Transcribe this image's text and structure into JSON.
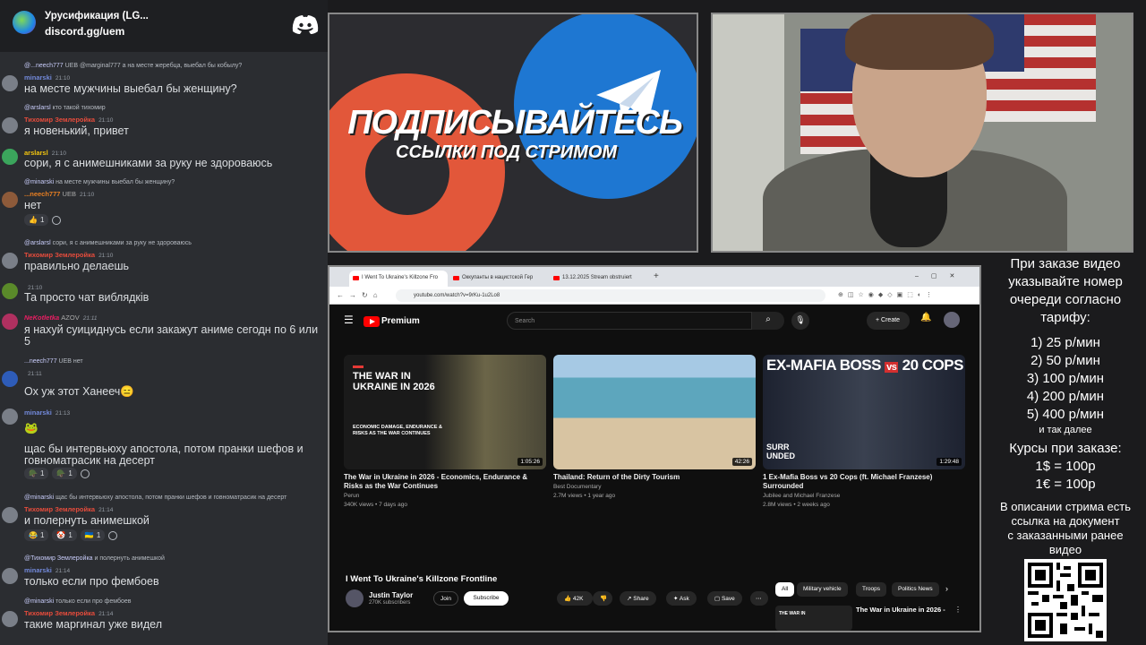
{
  "chat": {
    "server_name": "Урусификация (LG...",
    "invite": "discord.gg/uem",
    "messages": [
      {
        "reply_name": "@...neech777",
        "reply_badges": "UEB",
        "reply_text": "@marginal777 а на месте жеребца, выебал бы кобылу?",
        "author": "minarski",
        "author_color": "#7289da",
        "time": "21:10",
        "text": "на месте мужчины выебал бы женщину?"
      },
      {
        "reply_name": "@arslarsl",
        "reply_text": "кто такой тихомир",
        "author": "Тихомир Землеройка",
        "author_color": "#e74c3c",
        "time": "21:10",
        "text": "я новенький, привет"
      },
      {
        "author": "arslarsl",
        "author_color": "#f1c40f",
        "time": "21:10",
        "text": "сори, я с анимешниками за руку не здороваюсь"
      },
      {
        "reply_name": "@minarski",
        "reply_text": "на месте мужчины выебал бы женщину?",
        "author": "...neech777",
        "author_color": "#e67e22",
        "badges": "UEB",
        "time": "21:10",
        "text": "нет",
        "reactions": [
          {
            "emoji": "👍",
            "count": "1"
          }
        ]
      },
      {
        "reply_name": "@arslarsl",
        "reply_text": "сори, я с анимешниками за руку не здороваюсь",
        "author": "Тихомир Землеройка",
        "author_color": "#e74c3c",
        "time": "21:10",
        "text": "правильно делаешь"
      },
      {
        "author": "",
        "time": "21:10",
        "text": "Та просто чат виблядків"
      },
      {
        "author": "NeKotletka",
        "author_color": "#e91e63",
        "badges": "AZOV",
        "time": "21:11",
        "text": "я нахуй суициднусь если закажут  аниме сегодн по 6 или 5"
      },
      {
        "reply_name": "...neech777",
        "reply_badges": "UEB",
        "reply_text": "нет",
        "author": "",
        "time": "21:11",
        "text": "Ох уж этот Ханееч😑"
      },
      {
        "author": "minarski",
        "author_color": "#7289da",
        "time": "21:13",
        "text": "🐸",
        "text2": "щас бы интервьюху апостола, потом пранки шефов и говноматрасик на десерт",
        "reactions": [
          {
            "emoji": "🪖",
            "count": "1"
          },
          {
            "emoji": "🪖",
            "count": "1"
          }
        ]
      },
      {
        "reply_name": "@minarski",
        "reply_text": "щас бы интервьюху апостола, потом пранки шефов и говноматрасик на десерт",
        "author": "Тихомир Землеройка",
        "author_color": "#e74c3c",
        "time": "21:14",
        "text": "и полернуть анимешкой",
        "reactions": [
          {
            "emoji": "😂",
            "count": "1"
          },
          {
            "emoji": "🤡",
            "count": "1"
          },
          {
            "emoji": "🇺🇦",
            "count": "1"
          }
        ]
      },
      {
        "reply_name": "@Тихомир Землеройка",
        "reply_text": "и полернуть анимешкой",
        "author": "minarski",
        "author_color": "#7289da",
        "time": "21:14",
        "text": "только если про фембоев"
      },
      {
        "reply_name": "@minarski",
        "reply_text": "только если про фембоев",
        "author": "Тихомир Землеройка",
        "author_color": "#e74c3c",
        "time": "21:14",
        "text": "такие маргинал уже видел"
      }
    ]
  },
  "promo": {
    "title": "ПОДПИСЫВАЙТЕСЬ",
    "subtitle": "ССЫЛКИ ПОД СТРИМОМ"
  },
  "browser": {
    "tabs": [
      "I Went To Ukraine's Killzone Fro",
      "Оккупанты в нацистской Гер",
      "13.12.2025 Stream obstruiert"
    ],
    "url": "youtube.com/watch?v=9rKu-1u2Lo8",
    "search_placeholder": "Search",
    "brand": "Premium",
    "create_label": "Create",
    "videos": [
      {
        "title": "The War in Ukraine in 2026 - Economics, Endurance & Risks as the War Continues",
        "channel": "Perun",
        "meta": "340K views • 7 days ago",
        "duration": "1:05:26",
        "thumb_text": "THE WAR IN UKRAINE IN 2026",
        "thumb_sub": "ECONOMIC DAMAGE, ENDURANCE & RISKS AS THE WAR CONTINUES"
      },
      {
        "title": "Thailand: Return of the Dirty Tourism",
        "channel": "Best Documentary",
        "meta": "2.7M views • 1 year ago",
        "duration": "42:26"
      },
      {
        "title": "1 Ex-Mafia Boss vs 20 Cops (ft. Michael Franzese) Surrounded",
        "channel": "Jubilee and Michael Franzese",
        "meta": "2.8M views • 2 weeks ago",
        "duration": "1:29:48",
        "thumb_text": "EX-MAFIA BOSS",
        "thumb_vs": "vs",
        "thumb_right": "20 COPS",
        "thumb_corner": "SURR UNDED"
      }
    ],
    "main_title": "I Went To Ukraine's Killzone Frontline",
    "channel_name": "Justin Taylor",
    "channel_subs": "270K subscribers",
    "join_label": "Join",
    "subscribe_label": "Subscribe",
    "likes": "42K",
    "share_label": "Share",
    "ask_label": "Ask",
    "save_label": "Save",
    "chips": [
      "All",
      "Military vehicle",
      "Troops",
      "Politics News"
    ],
    "side_title": "The War in Ukraine in 2026 -",
    "side_thumb_text": "THE WAR IN"
  },
  "info": {
    "lines": [
      "При заказе видео",
      "указывайте номер",
      "очереди согласно",
      "тарифу:",
      "1) 25 р/мин",
      "2) 50 р/мин",
      "3) 100 р/мин",
      "4) 200 р/мин",
      "5) 400 р/мин"
    ],
    "and_so_on": "и так далее",
    "rates_title": "Курсы при заказе:",
    "rate_usd": "1$ = 100р",
    "rate_eur": "1€ = 100р",
    "desc_lines": [
      "В описании стрима есть",
      "ссылка на документ",
      "с заказанными ранее",
      "видео"
    ]
  }
}
